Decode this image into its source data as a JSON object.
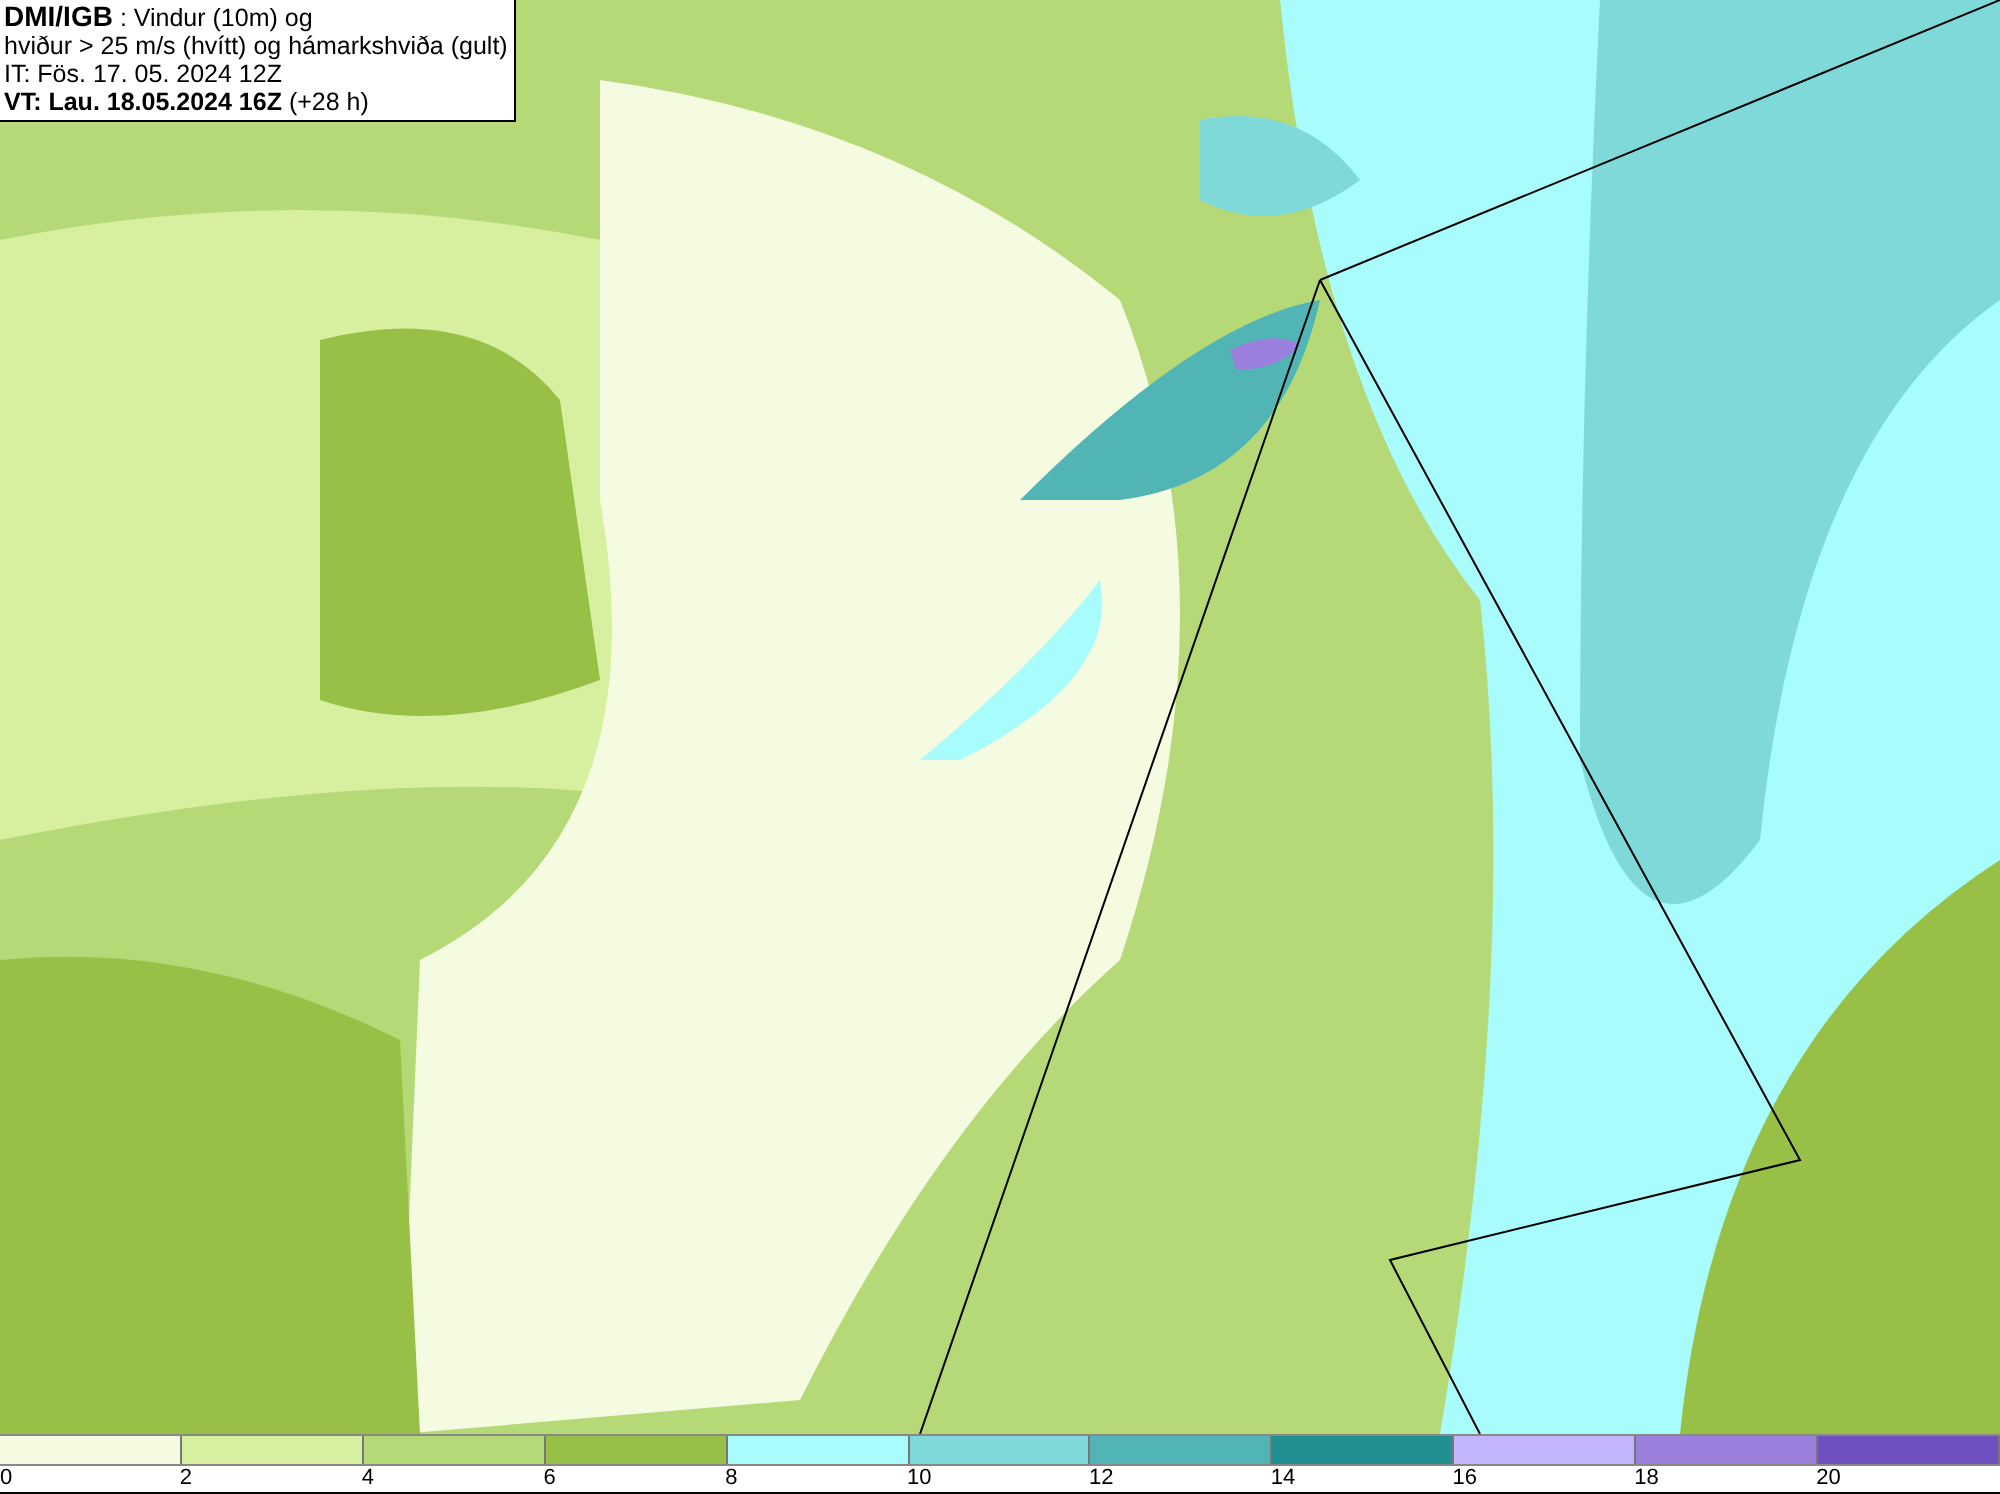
{
  "header": {
    "source": "DMI/IGB",
    "title_line_1": ": Vindur (10m) og",
    "title_line_2": "hviður > 25 m/s (hvítt) og hámarkshviða (gult)",
    "issue_time": "IT: Fös. 17. 05. 2024 12Z",
    "valid_time": "VT: Lau. 18.05.2024 16Z",
    "lead_time": "(+28 h)"
  },
  "legend": {
    "segments": [
      {
        "color": "#f4fbe0"
      },
      {
        "color": "#d6f0a0"
      },
      {
        "color": "#b5d977"
      },
      {
        "color": "#98c046"
      },
      {
        "color": "#a8fcfc"
      },
      {
        "color": "#7fd9d9"
      },
      {
        "color": "#52b5b5"
      },
      {
        "color": "#229090"
      },
      {
        "color": "#c3b5fc"
      },
      {
        "color": "#9a80dc"
      },
      {
        "color": "#7050c0"
      }
    ],
    "ticks": [
      "0",
      "2",
      "4",
      "6",
      "8",
      "10",
      "12",
      "14",
      "16",
      "18",
      "20"
    ]
  }
}
